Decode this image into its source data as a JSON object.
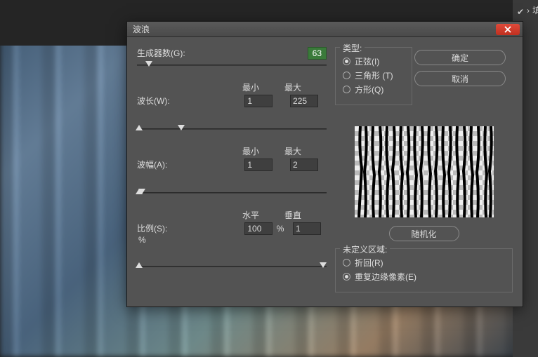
{
  "rightpanel": {
    "item1": "填充"
  },
  "dialog": {
    "title": "波浪",
    "generators": {
      "label": "生成器数(G):",
      "value": "63"
    },
    "wavelength": {
      "label": "波长(W):",
      "min_label": "最小",
      "max_label": "最大",
      "min": "1",
      "max": "225"
    },
    "amplitude": {
      "label": "波幅(A):",
      "min_label": "最小",
      "max_label": "最大",
      "min": "1",
      "max": "2"
    },
    "scale": {
      "label": "比例(S):",
      "h_label": "水平",
      "v_label": "垂直",
      "h": "100",
      "v": "1",
      "pct": "%"
    },
    "type": {
      "legend": "类型:",
      "sine": "正弦(I)",
      "triangle": "三角形 (T)",
      "square": "方形(Q)"
    },
    "undefined": {
      "legend": "未定义区域:",
      "wrap": "折回(R)",
      "repeat": "重复边缘像素(E)"
    },
    "ok": "确定",
    "cancel": "取消",
    "randomize": "随机化"
  }
}
